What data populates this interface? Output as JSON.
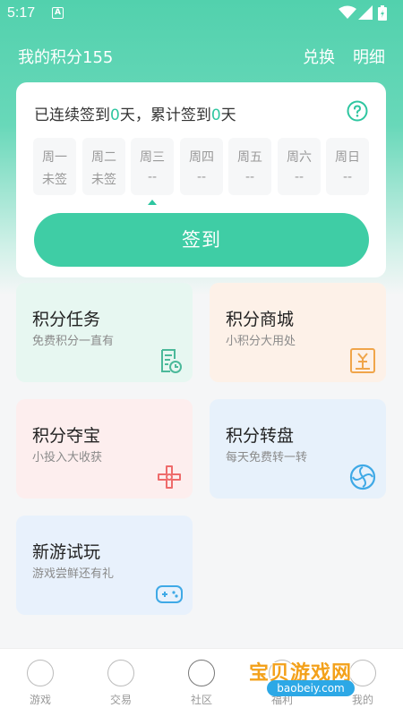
{
  "status_bar": {
    "time": "5:17",
    "app_badge": "A"
  },
  "header": {
    "title": "我的积分155",
    "exchange": "兑换",
    "detail": "明细"
  },
  "sign_card": {
    "summary_pre": "已连续签到",
    "continuous_days": "0",
    "summary_mid": "天，累计签到",
    "total_days": "0",
    "summary_post": "天",
    "days": [
      {
        "name": "周一",
        "status": "未签"
      },
      {
        "name": "周二",
        "status": "未签"
      },
      {
        "name": "周三",
        "status": "--"
      },
      {
        "name": "周四",
        "status": "--"
      },
      {
        "name": "周五",
        "status": "--"
      },
      {
        "name": "周六",
        "status": "--"
      },
      {
        "name": "周日",
        "status": "--"
      }
    ],
    "sign_button": "签到"
  },
  "features": {
    "task": {
      "title": "积分任务",
      "subtitle": "免费积分一直有",
      "icon": "task-clock-icon",
      "color": "#4bb99a"
    },
    "mall": {
      "title": "积分商城",
      "subtitle": "小积分大用处",
      "icon": "shop-icon",
      "color": "#f0a54a"
    },
    "treasure": {
      "title": "积分夺宝",
      "subtitle": "小投入大收获",
      "icon": "windmill-icon",
      "color": "#ee6b6b"
    },
    "wheel": {
      "title": "积分转盘",
      "subtitle": "每天免费转一转",
      "icon": "spin-wheel-icon",
      "color": "#3fa9e6"
    },
    "trial": {
      "title": "新游试玩",
      "subtitle": "游戏尝鲜还有礼",
      "icon": "gamepad-icon",
      "color": "#3fa9e6"
    }
  },
  "bottom_nav": [
    {
      "label": "游戏",
      "icon": "game-icon"
    },
    {
      "label": "交易",
      "icon": "trade-icon"
    },
    {
      "label": "社区",
      "icon": "community-icon"
    },
    {
      "label": "福利",
      "icon": "welfare-icon"
    },
    {
      "label": "我的",
      "icon": "profile-icon"
    }
  ],
  "watermark": {
    "text": "宝贝游戏网",
    "url": "baobeiy.com"
  }
}
